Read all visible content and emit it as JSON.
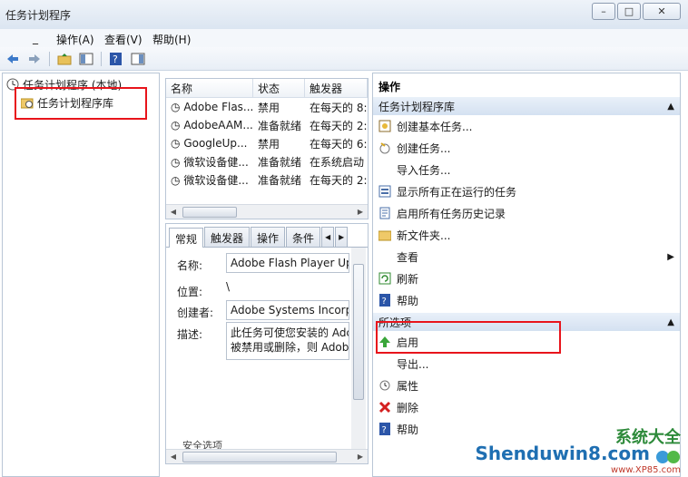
{
  "window": {
    "title": "任务计划程序"
  },
  "menu": {
    "file": "_",
    "action": "操作(A)",
    "view": "查看(V)",
    "help": "帮助(H)"
  },
  "tree": {
    "root": "任务计划程序 (本地)",
    "library": "任务计划程序库"
  },
  "tasks": {
    "columns": [
      "名称",
      "状态",
      "触发器"
    ],
    "rows": [
      {
        "name": "Adobe Flas...",
        "status": "禁用",
        "trigger": "在每天的 8:"
      },
      {
        "name": "AdobeAAM...",
        "status": "准备就绪",
        "trigger": "在每天的 2:"
      },
      {
        "name": "GoogleUp...",
        "status": "禁用",
        "trigger": "在每天的 6:"
      },
      {
        "name": "微软设备健...",
        "status": "准备就绪",
        "trigger": "在系统启动"
      },
      {
        "name": "微软设备健...",
        "status": "准备就绪",
        "trigger": "在每天的 2:"
      }
    ]
  },
  "details": {
    "tabs": [
      "常规",
      "触发器",
      "操作",
      "条件"
    ],
    "name_label": "名称:",
    "name_value": "Adobe Flash Player Upc",
    "location_label": "位置:",
    "location_value": "\\",
    "author_label": "创建者:",
    "author_value": "Adobe Systems Incorpo",
    "desc_label": "描述:",
    "desc_line1": "此任务可使您安装的 Adc",
    "desc_line2": "被禁用或删除，则 Adobe",
    "security": "安全选项"
  },
  "actions": {
    "header": "操作",
    "section1": "任务计划程序库",
    "items1": [
      "创建基本任务...",
      "创建任务...",
      "导入任务...",
      "显示所有正在运行的任务",
      "启用所有任务历史记录",
      "新文件夹...",
      "查看",
      "刷新",
      "帮助"
    ],
    "section2": "所选项",
    "items2": [
      "启用",
      "导出...",
      "属性",
      "删除",
      "帮助"
    ]
  },
  "watermark": {
    "brand": "Shenduwin8.com",
    "cn": "系统大全",
    "site": "www.XP85.com"
  },
  "colors": {
    "highlight": "#e8141b",
    "section_bg": "#d4e1f1"
  }
}
